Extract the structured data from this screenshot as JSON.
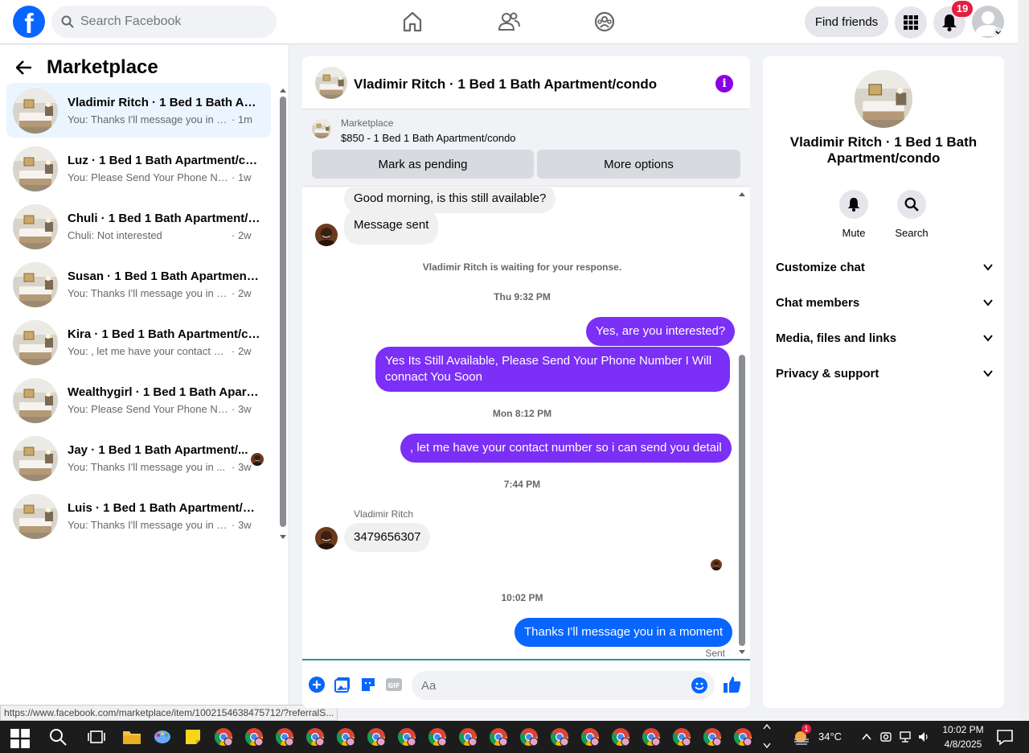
{
  "topbar": {
    "search_placeholder": "Search Facebook",
    "find_friends": "Find friends",
    "notification_count": "19"
  },
  "left": {
    "title": "Marketplace",
    "conversations": [
      {
        "name": "Vladimir Ritch · 1 Bed 1 Bath Apa...",
        "snippet": "You: Thanks I'll message you in a ...",
        "time": "· 1m",
        "active": true
      },
      {
        "name": "Luz · 1 Bed 1 Bath Apartment/co...",
        "snippet": "You: Please Send Your Phone Num...",
        "time": "· 1w"
      },
      {
        "name": "Chuli · 1 Bed 1 Bath Apartment/c...",
        "snippet": "Chuli: Not interested",
        "time": "· 2w"
      },
      {
        "name": "Susan · 1 Bed 1 Bath Apartment/...",
        "snippet": "You: Thanks I'll message you in a ...",
        "time": "· 2w"
      },
      {
        "name": "Kira · 1 Bed 1 Bath Apartment/co...",
        "snippet": "You: , let me have your contact nu...",
        "time": "· 2w"
      },
      {
        "name": "Wealthygirl · 1 Bed 1 Bath Apart...",
        "snippet": "You: Please Send Your Phone Num...",
        "time": "· 3w"
      },
      {
        "name": "Jay · 1 Bed 1 Bath Apartment/...",
        "snippet": "You: Thanks I'll message you in ...",
        "time": "· 3w"
      },
      {
        "name": "Luis · 1 Bed 1 Bath Apartment/co...",
        "snippet": "You: Thanks I'll message you in a ...",
        "time": "· 3w"
      }
    ]
  },
  "status_url": "https://www.facebook.com/marketplace/item/1002154638475712/?referralS...",
  "chat": {
    "header_title": "Vladimir Ritch · 1 Bed 1 Bath Apartment/condo",
    "listing_source": "Marketplace",
    "listing_price_title": "$850 - 1 Bed 1 Bath Apartment/condo",
    "mark_pending": "Mark as pending",
    "more_options": "More options",
    "msg_good_morning": "Good morning, is this still available?",
    "msg_sent": "Message sent",
    "waiting": "Vladimir Ritch is waiting for your response.",
    "ts_thu": "Thu 9:32 PM",
    "msg_interested": "Yes, are you interested?",
    "msg_still_available": "Yes Its Still Available, Please Send Your Phone Number I Will connact You Soon",
    "ts_mon": "Mon 8:12 PM",
    "msg_contact": ", let me have your contact number so i can send you detail",
    "ts_744": "7:44 PM",
    "sender_name": "Vladimir Ritch",
    "msg_number": "3479656307",
    "ts_1002": "10:02 PM",
    "msg_thanks": "Thanks I'll message you in a moment",
    "sent_label": "Sent",
    "composer_placeholder": "Aa"
  },
  "right": {
    "title": "Vladimir Ritch · 1 Bed 1 Bath Apartment/condo",
    "mute": "Mute",
    "search": "Search",
    "sections": [
      "Customize chat",
      "Chat members",
      "Media, files and links",
      "Privacy & support"
    ]
  },
  "taskbar": {
    "temperature": "34°C",
    "time": "10:02 PM",
    "date": "4/8/2025",
    "weather_badge": "1"
  },
  "colors": {
    "accent": "#0866ff",
    "outgoing": "#7b2ff7",
    "info": "#8a00e6"
  }
}
